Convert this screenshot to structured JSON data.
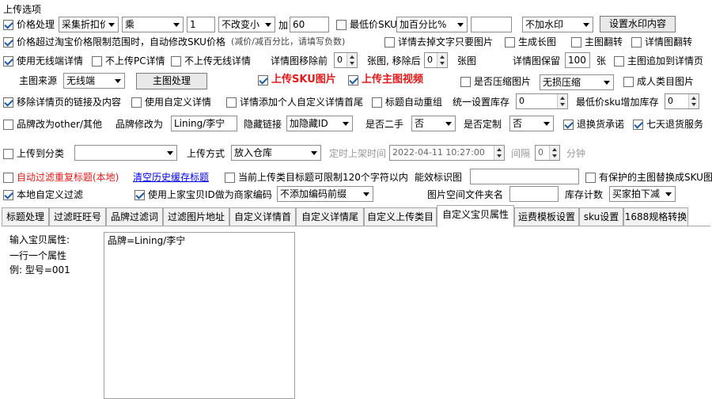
{
  "section_title": "上传选项",
  "row1": {
    "price_process": "价格处理",
    "price_mode": "采集折扣价",
    "op": "乘",
    "factor": "1",
    "rounding": "不改变小",
    "plus_label": "加",
    "plus_value": "60",
    "min_sku": "最低价SKU",
    "add_percent": "加百分比%",
    "add_percent_value": "",
    "watermark": "不加水印",
    "set_watermark_btn": "设置水印内容"
  },
  "row2": {
    "over_limit": "价格超过淘宝价格限制范围时，自动修改SKU价格",
    "over_limit_hint": "(减价/减百分比，请填写负数)",
    "detail_remove_text": "详情去掉文字只要图片",
    "gen_long": "生成长图",
    "main_flip": "主图翻转",
    "detail_flip": "详情图翻转"
  },
  "row3": {
    "wireless_detail": "使用无线端详情",
    "no_pc": "不上传PC详情",
    "no_wireless": "不上传无线详情",
    "detail_remove_before": "详情图移除前",
    "remove_before_value": "0",
    "remove_after_label": "张图, 移除后",
    "remove_after_value": "0",
    "img_unit": "张图",
    "detail_keep": "详情图保留",
    "keep_value": "100",
    "keep_unit": "张",
    "main_append": "主图追加到详情页"
  },
  "row4": {
    "main_source_label": "主图来源",
    "main_source": "无线端",
    "main_process_btn": "主图处理",
    "upload_sku_img": "上传SKU图片",
    "upload_main_video": "上传主图视频",
    "compress": "是否压缩图片",
    "compress_mode": "无损压缩",
    "adult": "成人类目图片"
  },
  "row5": {
    "remove_links": "移除详情页的链接及内容",
    "custom_detail": "使用自定义详情",
    "add_personal": "详情添加个人自定义详情首尾",
    "title_reorg": "标题自动重组",
    "stock_label": "统一设置库存",
    "stock_value": "0",
    "min_sku_add_label": "最低价sku增加库存",
    "min_sku_add_value": "0"
  },
  "row6": {
    "brand_other": "品牌改为other/其他",
    "brand_change_label": "品牌修改为",
    "brand_value": "Lining/李宁",
    "hidden_link_label": "隐藏链接",
    "hidden_link": "加隐藏ID",
    "second_hand_label": "是否二手",
    "second_hand": "否",
    "custom_label": "是否定制",
    "custom": "否",
    "return_promise": "退换货承诺",
    "seven_day": "七天退货服务"
  },
  "row7": {
    "upload_category": "上传到分类",
    "category_value": "",
    "upload_method_label": "上传方式",
    "upload_method": "放入仓库",
    "timed_label": "定时上架时间",
    "timed_value": "2022-04-11 10:27:00",
    "interval_label": "间隔",
    "interval_value": "0",
    "minute_label": "分钟"
  },
  "row8": {
    "auto_filter": "自动过滤重复标题(本地)",
    "clear_history": "清空历史缓存标题",
    "title_limit": "当前上传类目标题可限制120个字符以内",
    "ident_img_label": "能效标识图",
    "ident_img_value": "",
    "protected_main": "有保护的主图替换成SKU图"
  },
  "row9": {
    "local_filter": "本地自定义过滤",
    "use_prev_id": "使用上家宝贝ID做为商家编码",
    "code_prefix": "不添加编码前缀",
    "folder_label": "图片空间文件夹名",
    "folder_value": "",
    "stock_count_label": "库存计数",
    "stock_count": "买家拍下减"
  },
  "tabs": [
    {
      "label": "标题处理"
    },
    {
      "label": "过滤旺旺号"
    },
    {
      "label": "品牌过滤词"
    },
    {
      "label": "过滤图片地址"
    },
    {
      "label": "自定义详情首"
    },
    {
      "label": "自定义详情尾"
    },
    {
      "label": "自定义上传类目"
    },
    {
      "label": "自定义宝贝属性"
    },
    {
      "label": "运费模板设置"
    },
    {
      "label": "sku设置"
    },
    {
      "label": "1688规格转换"
    }
  ],
  "panel": {
    "hint_line1": "输入宝贝属性:",
    "hint_line2": "一行一个属性",
    "hint_line3": "例: 型号=001",
    "attr_text": "品牌=Lining/李宁"
  }
}
